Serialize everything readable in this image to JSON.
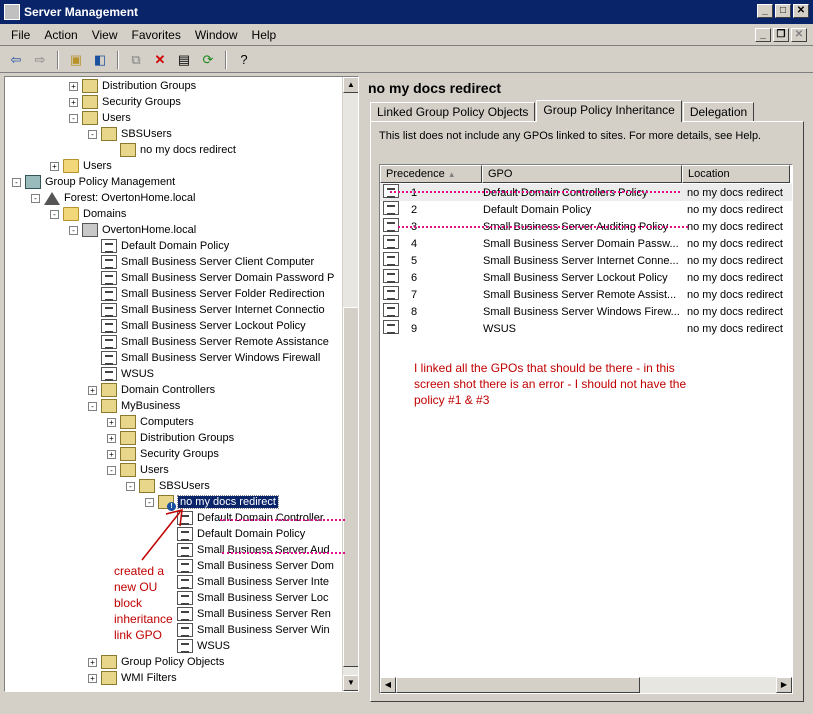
{
  "window": {
    "title": "Server Management"
  },
  "menu": [
    "File",
    "Action",
    "View",
    "Favorites",
    "Window",
    "Help"
  ],
  "toolbar_icons": [
    "back-icon",
    "forward-icon",
    "up-folder-icon",
    "show-hide-tree-icon",
    "copy-icon",
    "delete-icon",
    "properties-icon",
    "refresh-icon",
    "help-icon"
  ],
  "tree": [
    {
      "label": "Distribution Groups",
      "icon": "folder-ou",
      "level": 4,
      "exp": "+"
    },
    {
      "label": "Security Groups",
      "icon": "folder-ou",
      "level": 4,
      "exp": "+"
    },
    {
      "label": "Users",
      "icon": "folder-ou",
      "level": 4,
      "exp": "-"
    },
    {
      "label": "SBSUsers",
      "icon": "folder-ou",
      "level": 5,
      "exp": "-"
    },
    {
      "label": "no my docs redirect",
      "icon": "folder-ou",
      "level": 6,
      "exp": ""
    },
    {
      "label": "Users",
      "icon": "folder",
      "level": 3,
      "exp": "+"
    },
    {
      "label": "Group Policy Management",
      "icon": "mgmt",
      "level": 1,
      "exp": "-"
    },
    {
      "label": "Forest: OvertonHome.local",
      "icon": "forest",
      "level": 2,
      "exp": "-"
    },
    {
      "label": "Domains",
      "icon": "folder",
      "level": 3,
      "exp": "-"
    },
    {
      "label": "OvertonHome.local",
      "icon": "domain",
      "level": 4,
      "exp": "-"
    },
    {
      "label": "Default Domain Policy",
      "icon": "gpo",
      "level": 5,
      "exp": ""
    },
    {
      "label": "Small Business Server Client Computer",
      "icon": "gpo",
      "level": 5,
      "exp": ""
    },
    {
      "label": "Small Business Server Domain Password P",
      "icon": "gpo",
      "level": 5,
      "exp": ""
    },
    {
      "label": "Small Business Server Folder Redirection",
      "icon": "gpo",
      "level": 5,
      "exp": ""
    },
    {
      "label": "Small Business Server Internet Connectio",
      "icon": "gpo",
      "level": 5,
      "exp": ""
    },
    {
      "label": "Small Business Server Lockout Policy",
      "icon": "gpo",
      "level": 5,
      "exp": ""
    },
    {
      "label": "Small Business Server Remote Assistance",
      "icon": "gpo",
      "level": 5,
      "exp": ""
    },
    {
      "label": "Small Business Server Windows Firewall",
      "icon": "gpo",
      "level": 5,
      "exp": ""
    },
    {
      "label": "WSUS",
      "icon": "gpo",
      "level": 5,
      "exp": ""
    },
    {
      "label": "Domain Controllers",
      "icon": "folder-ou",
      "level": 5,
      "exp": "+"
    },
    {
      "label": "MyBusiness",
      "icon": "folder-ou",
      "level": 5,
      "exp": "-"
    },
    {
      "label": "Computers",
      "icon": "folder-ou",
      "level": 6,
      "exp": "+"
    },
    {
      "label": "Distribution Groups",
      "icon": "folder-ou",
      "level": 6,
      "exp": "+"
    },
    {
      "label": "Security Groups",
      "icon": "folder-ou",
      "level": 6,
      "exp": "+"
    },
    {
      "label": "Users",
      "icon": "folder-ou",
      "level": 6,
      "exp": "-"
    },
    {
      "label": "SBSUsers",
      "icon": "folder-ou",
      "level": 7,
      "exp": "-"
    },
    {
      "label": "no my docs redirect",
      "icon": "folder-ou-blocked",
      "level": 8,
      "exp": "-",
      "selected": true
    },
    {
      "label": "Default Domain Controller",
      "icon": "gpo",
      "level": 9,
      "exp": ""
    },
    {
      "label": "Default Domain Policy",
      "icon": "gpo",
      "level": 9,
      "exp": ""
    },
    {
      "label": "Small Business Server Aud",
      "icon": "gpo",
      "level": 9,
      "exp": ""
    },
    {
      "label": "Small Business Server Dom",
      "icon": "gpo",
      "level": 9,
      "exp": ""
    },
    {
      "label": "Small Business Server Inte",
      "icon": "gpo",
      "level": 9,
      "exp": ""
    },
    {
      "label": "Small Business Server Loc",
      "icon": "gpo",
      "level": 9,
      "exp": ""
    },
    {
      "label": "Small Business Server Ren",
      "icon": "gpo",
      "level": 9,
      "exp": ""
    },
    {
      "label": "Small Business Server Win",
      "icon": "gpo",
      "level": 9,
      "exp": ""
    },
    {
      "label": "WSUS",
      "icon": "gpo",
      "level": 9,
      "exp": ""
    },
    {
      "label": "Group Policy Objects",
      "icon": "folder-ou",
      "level": 5,
      "exp": "+"
    },
    {
      "label": "WMI Filters",
      "icon": "folder-ou",
      "level": 5,
      "exp": "+"
    }
  ],
  "right_pane": {
    "title": "no my docs redirect",
    "tabs": [
      "Linked Group Policy Objects",
      "Group Policy Inheritance",
      "Delegation"
    ],
    "active_tab": 1,
    "info": "This list does not include any GPOs linked to sites. For more details, see Help.",
    "columns": [
      "Precedence",
      "GPO",
      "Location"
    ],
    "rows": [
      {
        "prec": "1",
        "gpo": "Default Domain Controllers Policy",
        "loc": "no my docs redirect"
      },
      {
        "prec": "2",
        "gpo": "Default Domain Policy",
        "loc": "no my docs redirect"
      },
      {
        "prec": "3",
        "gpo": "Small Business Server Auditing Policy",
        "loc": "no my docs redirect"
      },
      {
        "prec": "4",
        "gpo": "Small Business Server Domain Passw...",
        "loc": "no my docs redirect"
      },
      {
        "prec": "5",
        "gpo": "Small Business Server Internet Conne...",
        "loc": "no my docs redirect"
      },
      {
        "prec": "6",
        "gpo": "Small Business Server Lockout Policy",
        "loc": "no my docs redirect"
      },
      {
        "prec": "7",
        "gpo": "Small Business Server Remote Assist...",
        "loc": "no my docs redirect"
      },
      {
        "prec": "8",
        "gpo": "Small Business Server Windows Firew...",
        "loc": "no my docs redirect"
      },
      {
        "prec": "9",
        "gpo": "WSUS",
        "loc": "no my docs redirect"
      }
    ],
    "note_lines": [
      "I linked all the GPOs that should be there - in this",
      "screen shot there is an error - I should not have the",
      "policy #1 & #3"
    ]
  },
  "tree_note_lines": [
    "created a",
    "new OU",
    "block",
    "inheritance",
    "link GPO"
  ],
  "colors": {
    "title_bar": "#0a246a",
    "annotation_red": "#c00000",
    "scribble_pink": "#e0108a"
  }
}
